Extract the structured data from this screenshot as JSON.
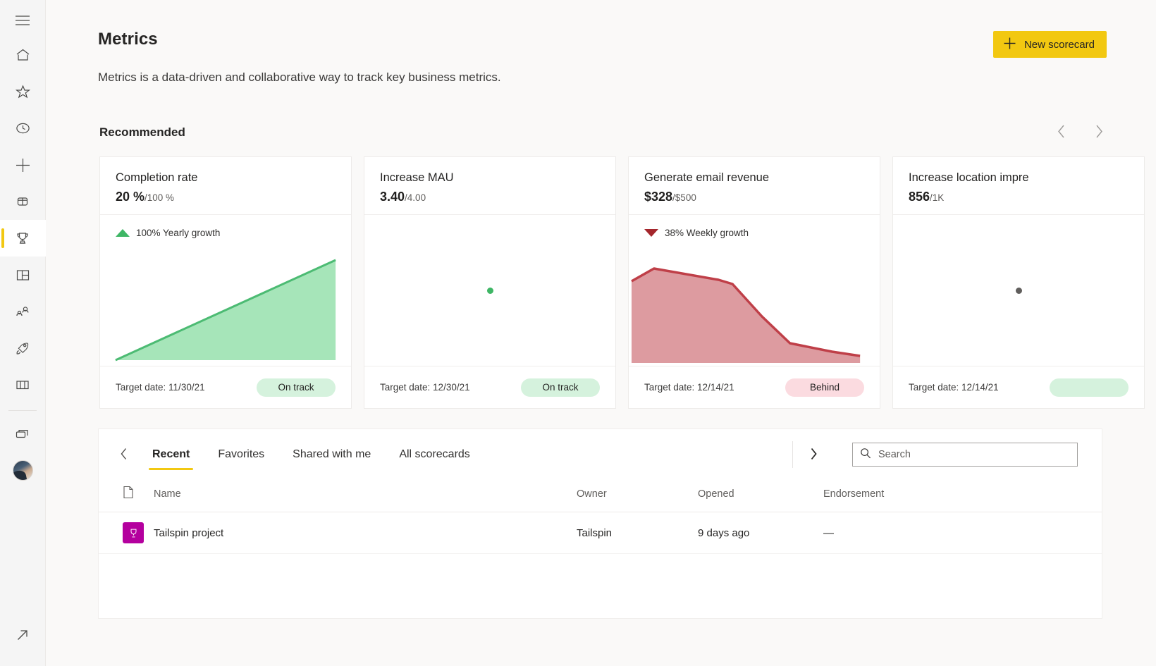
{
  "rail": {
    "items": [
      {
        "name": "hamburger-menu",
        "icon": "hamburger"
      },
      {
        "name": "home",
        "icon": "home"
      },
      {
        "name": "favorites",
        "icon": "star"
      },
      {
        "name": "recent",
        "icon": "clock"
      },
      {
        "name": "create",
        "icon": "plus"
      },
      {
        "name": "datahub",
        "icon": "database"
      },
      {
        "name": "goals",
        "icon": "trophy",
        "active": true
      },
      {
        "name": "apps",
        "icon": "apps"
      },
      {
        "name": "deployment-pipelines",
        "icon": "pipelines"
      },
      {
        "name": "learn",
        "icon": "rocket"
      },
      {
        "name": "workspaces",
        "icon": "book"
      },
      {
        "name": "my-workspace",
        "icon": "workspace"
      }
    ],
    "external_link": "external-link"
  },
  "header": {
    "title": "Metrics",
    "subtitle": "Metrics is a data-driven and collaborative way to track key business metrics.",
    "new_button_label": "New scorecard",
    "new_button_icon": "plus-icon",
    "accent_color": "#f2c811"
  },
  "recommended": {
    "title": "Recommended",
    "prev_icon": "chevron-left-icon",
    "next_icon": "chevron-right-icon",
    "cards": [
      {
        "name": "Completion rate",
        "value": "20 %",
        "target": "/100 %",
        "growth_text": "100% Yearly growth",
        "growth_direction": "up",
        "growth_color": "#3eb665",
        "chart_type": "area",
        "chart_color": "#3eb665",
        "chart_fill": "#a6e5b9",
        "target_date": "Target date: 11/30/21",
        "status": "On track",
        "status_style": "ontrack"
      },
      {
        "name": "Increase MAU",
        "value": "3.40",
        "target": "/4.00",
        "growth_text": "",
        "growth_direction": "none",
        "chart_type": "dot",
        "chart_color": "#3eb665",
        "target_date": "Target date: 12/30/21",
        "status": "On track",
        "status_style": "ontrack"
      },
      {
        "name": "Generate email revenue",
        "value": "$328",
        "target": "/$500",
        "growth_text": "38% Weekly growth",
        "growth_direction": "down",
        "growth_color": "#a4262c",
        "chart_type": "area",
        "chart_color": "#c03a43",
        "chart_fill": "#dd9ba0",
        "target_date": "Target date: 12/14/21",
        "status": "Behind",
        "status_style": "behind"
      },
      {
        "name": "Increase location impre",
        "value": "856",
        "target": "/1K",
        "growth_text": "",
        "growth_direction": "none",
        "chart_type": "dot",
        "chart_color": "#605e5c",
        "target_date": "Target date: 12/14/21",
        "status": "",
        "status_style": "ontrack"
      }
    ]
  },
  "chart_data": [
    {
      "type": "area",
      "title": "Completion rate",
      "x": [
        0,
        1,
        2,
        3,
        4,
        5
      ],
      "values": [
        0,
        20,
        40,
        60,
        80,
        100
      ],
      "ylim": [
        0,
        100
      ],
      "grid": false,
      "legend": false
    },
    {
      "type": "scatter",
      "title": "Increase MAU",
      "x": [
        0
      ],
      "values": [
        3.4
      ],
      "ylim": [
        0,
        4
      ],
      "grid": false,
      "legend": false
    },
    {
      "type": "area",
      "title": "Generate email revenue",
      "x": [
        0,
        1,
        2,
        3,
        4,
        5,
        6,
        7
      ],
      "values": [
        78,
        92,
        88,
        80,
        76,
        40,
        14,
        8
      ],
      "ylim": [
        0,
        100
      ],
      "grid": false,
      "legend": false
    },
    {
      "type": "scatter",
      "title": "Increase location impre",
      "x": [
        0
      ],
      "values": [
        856
      ],
      "ylim": [
        0,
        1000
      ],
      "grid": false,
      "legend": false
    }
  ],
  "panel": {
    "prev_icon": "chevron-left-icon",
    "next_icon": "chevron-right-icon",
    "tabs": [
      {
        "label": "Recent",
        "active": true
      },
      {
        "label": "Favorites",
        "active": false
      },
      {
        "label": "Shared with me",
        "active": false
      },
      {
        "label": "All scorecards",
        "active": false
      }
    ],
    "search": {
      "placeholder": "Search",
      "value": "",
      "icon": "search-icon"
    },
    "table": {
      "columns": [
        "",
        "Name",
        "Owner",
        "Opened",
        "Endorsement"
      ],
      "rows": [
        {
          "icon": "scorecard-trophy-icon",
          "name": "Tailspin project",
          "owner": "Tailspin",
          "opened": "9 days ago",
          "endorsement": "—"
        }
      ]
    }
  }
}
